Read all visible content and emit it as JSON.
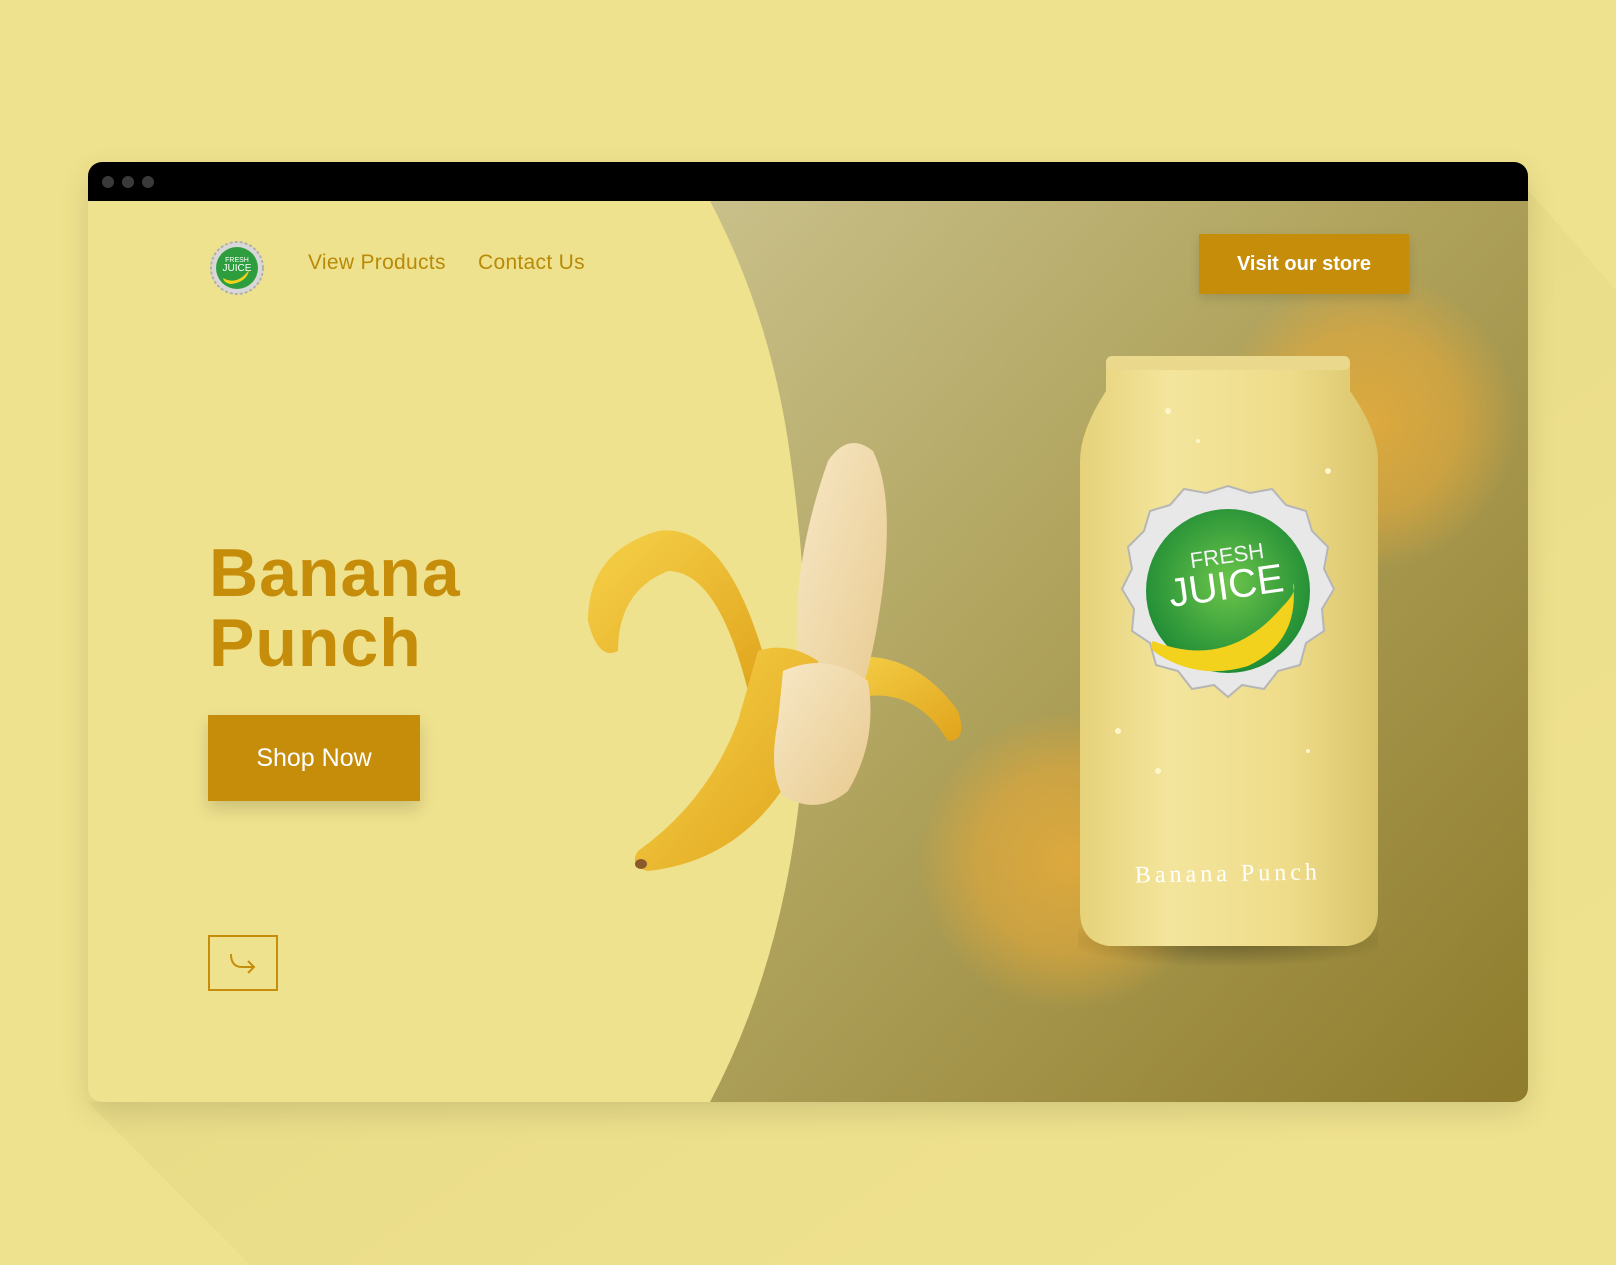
{
  "window": {
    "controls": [
      "close-dot",
      "minimize-dot",
      "maximize-dot"
    ]
  },
  "nav": {
    "logo": {
      "top_text": "FRESH",
      "bottom_text": "JUICE"
    },
    "links": [
      "View Products",
      "Contact Us"
    ],
    "cta": "Visit our store"
  },
  "hero": {
    "title_line1": "Banana",
    "title_line2": "Punch",
    "button": "Shop Now",
    "next_icon": "arrow-curve-right-icon"
  },
  "product": {
    "cap_top": "FRESH",
    "cap_bottom": "JUICE",
    "can_label": "Banana Punch"
  },
  "colors": {
    "background": "#efe28e",
    "accent": "#c68d0b",
    "olive": "#9a8a3a",
    "titlebar": "#000000"
  }
}
